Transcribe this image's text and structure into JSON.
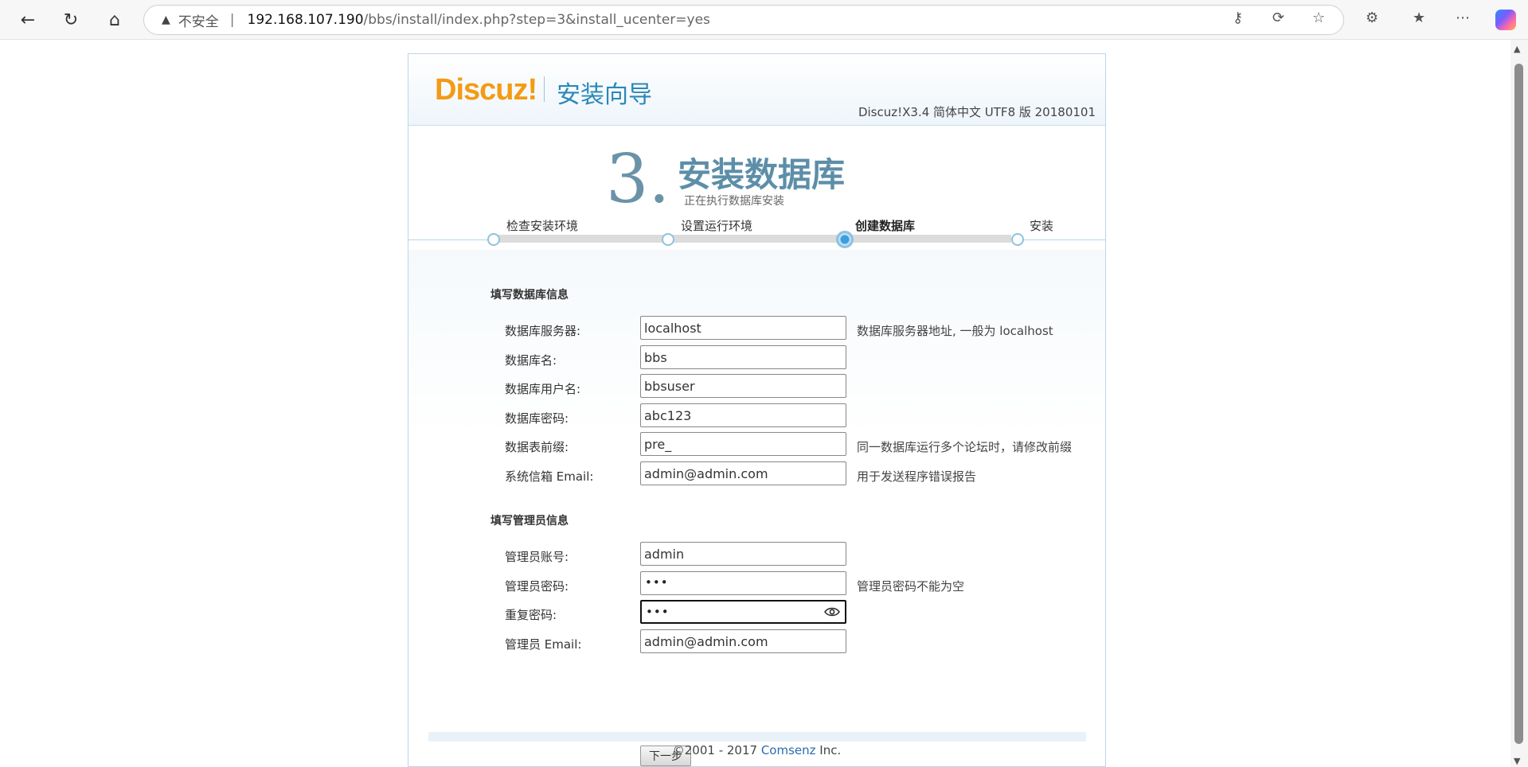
{
  "browser": {
    "security_label": "不安全",
    "separator": "|",
    "url_host": "192.168.107.190",
    "url_path": "/bbs/install/index.php?step=3&install_ucenter=yes"
  },
  "header": {
    "logo": "Discuz!",
    "wizard_title": "安装向导",
    "version": "Discuz!X3.4 简体中文 UTF8 版 20180101"
  },
  "step": {
    "number": "3.",
    "title": "安装数据库",
    "subtitle": "正在执行数据库安装"
  },
  "progress": {
    "steps": [
      "检查安装环境",
      "设置运行环境",
      "创建数据库",
      "安装"
    ],
    "active_index": 2
  },
  "db_section": {
    "title": "填写数据库信息",
    "rows": [
      {
        "label": "数据库服务器:",
        "value": "localhost",
        "hint": "数据库服务器地址, 一般为 localhost"
      },
      {
        "label": "数据库名:",
        "value": "bbs",
        "hint": ""
      },
      {
        "label": "数据库用户名:",
        "value": "bbsuser",
        "hint": ""
      },
      {
        "label": "数据库密码:",
        "value": "abc123",
        "hint": ""
      },
      {
        "label": "数据表前缀:",
        "value": "pre_",
        "hint": "同一数据库运行多个论坛时，请修改前缀"
      },
      {
        "label": "系统信箱 Email:",
        "value": "admin@admin.com",
        "hint": "用于发送程序错误报告"
      }
    ]
  },
  "admin_section": {
    "title": "填写管理员信息",
    "rows": [
      {
        "label": "管理员账号:",
        "value": "admin",
        "hint": ""
      },
      {
        "label": "管理员密码:",
        "value": "•••",
        "hint": "管理员密码不能为空"
      },
      {
        "label": "重复密码:",
        "value": "•••",
        "hint": ""
      },
      {
        "label": "管理员 Email:",
        "value": "admin@admin.com",
        "hint": ""
      }
    ]
  },
  "buttons": {
    "next": "下一步"
  },
  "footer": {
    "prefix": "©2001 - 2017 ",
    "brand": "Comsenz",
    "suffix": " Inc."
  },
  "colors": {
    "accent": "#2a88b8",
    "logo": "#f39b14",
    "step_title": "#5c8ea8"
  }
}
